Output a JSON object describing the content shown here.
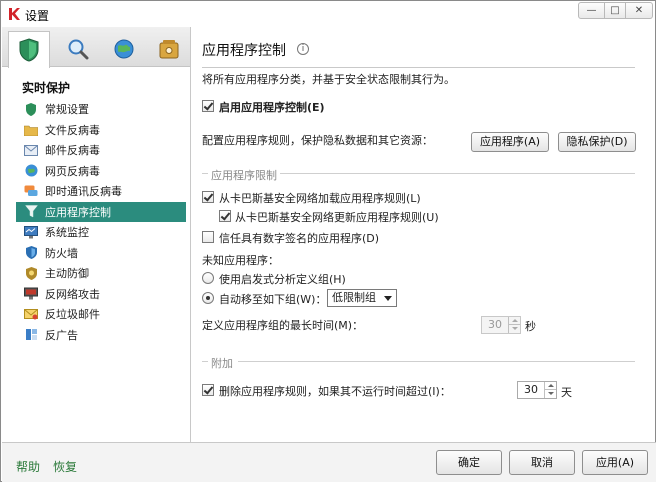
{
  "window": {
    "title": "设置",
    "controls": {
      "minimize": "—",
      "maximize": "□",
      "close": "✕"
    }
  },
  "sidebar": {
    "tabs": [
      {
        "icon": "shield-icon"
      },
      {
        "icon": "magnifier-icon"
      },
      {
        "icon": "globe-icon"
      },
      {
        "icon": "safe-icon"
      }
    ],
    "section_title": "实时保护",
    "items": [
      {
        "label": "常规设置",
        "icon": "shield-icon"
      },
      {
        "label": "文件反病毒",
        "icon": "folder-icon"
      },
      {
        "label": "邮件反病毒",
        "icon": "mail-icon"
      },
      {
        "label": "网页反病毒",
        "icon": "globe-icon"
      },
      {
        "label": "即时通讯反病毒",
        "icon": "chat-icon"
      },
      {
        "label": "应用程序控制",
        "icon": "filter-icon"
      },
      {
        "label": "系统监控",
        "icon": "monitor-icon"
      },
      {
        "label": "防火墙",
        "icon": "firewall-icon"
      },
      {
        "label": "主动防御",
        "icon": "defense-icon"
      },
      {
        "label": "反网络攻击",
        "icon": "network-attack-icon"
      },
      {
        "label": "反垃圾邮件",
        "icon": "spam-icon"
      },
      {
        "label": "反广告",
        "icon": "ad-block-icon"
      }
    ],
    "selected_index": 5
  },
  "main": {
    "title": "应用程序控制",
    "description": "将所有应用程序分类，并基于安全状态限制其行为。",
    "enable_label": "启用应用程序控制(E)",
    "enable_checked": true,
    "configure_label": "配置应用程序规则，保护隐私数据和其它资源：",
    "apps_button": "应用程序(A)",
    "privacy_button": "隐私保护(D)",
    "restrictions_group": "应用程序限制",
    "load_rules_label": "从卡巴斯基安全网络加载应用程序规则(L)",
    "load_rules_checked": true,
    "update_rules_label": "从卡巴斯基安全网络更新应用程序规则(U)",
    "update_rules_checked": true,
    "trust_signed_label": "信任具有数字签名的应用程序(D)",
    "trust_signed_checked": false,
    "unknown_label": "未知应用程序：",
    "heuristic_label": "使用启发式分析定义组(H)",
    "heuristic_selected": false,
    "auto_move_label": "自动移至如下组(W)：",
    "auto_move_selected": true,
    "group_value": "低限制组",
    "max_time_label": "定义应用程序组的最长时间(M)：",
    "max_time_value": "30",
    "max_time_unit": "秒",
    "extra_group": "附加",
    "delete_rules_label": "删除应用程序规则，如果其不运行时间超过(I)：",
    "delete_rules_checked": true,
    "delete_days_value": "30",
    "delete_days_unit": "天"
  },
  "footer": {
    "help": "帮助",
    "restore": "恢复",
    "ok": "确定",
    "cancel": "取消",
    "apply": "应用(A)"
  },
  "colors": {
    "selected_bg": "#2b8c7e",
    "link_green": "#2b7a3a",
    "logo_red": "#d2232a"
  }
}
